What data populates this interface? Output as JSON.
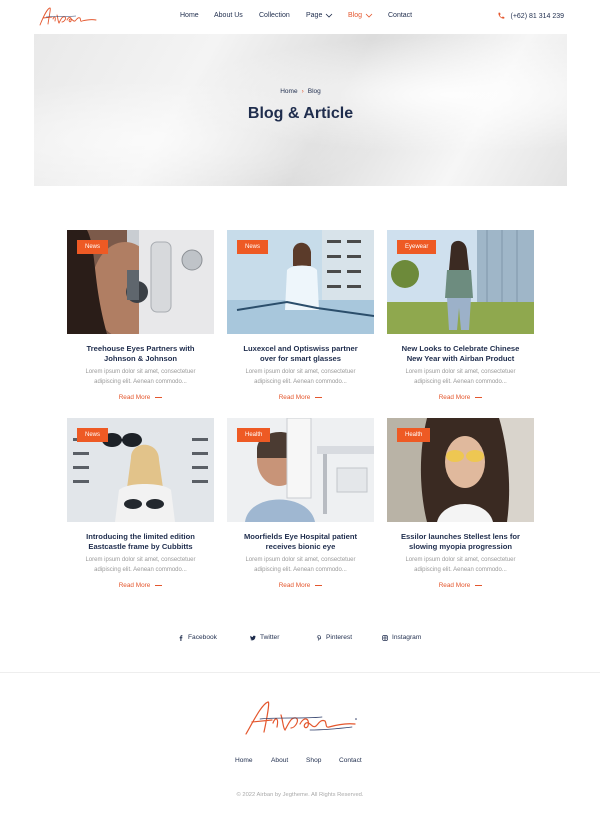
{
  "brand": {
    "name": "Airban",
    "accent": "#e4572e",
    "navy": "#1f2d4d"
  },
  "nav": {
    "items": [
      {
        "label": "Home"
      },
      {
        "label": "About Us"
      },
      {
        "label": "Collection"
      },
      {
        "label": "Page",
        "dropdown": true
      },
      {
        "label": "Blog",
        "dropdown": true,
        "active": true
      },
      {
        "label": "Contact"
      }
    ],
    "phone": "(+62) 81 314 239",
    "phone_icon": "phone-icon"
  },
  "hero": {
    "breadcrumb": {
      "home": "Home",
      "current": "Blog"
    },
    "title": "Blog & Article"
  },
  "cards": [
    {
      "tag": "News",
      "title_line1": "Treehouse Eyes Partners with",
      "title_line2": "Johnson & Johnson",
      "excerpt_line1": "Lorem ipsum dolor sit amet, consectetuer",
      "excerpt_line2": "adipiscing elit. Aenean commodo...",
      "read_more": "Read More"
    },
    {
      "tag": "News",
      "title_line1": "Luxexcel and Optiswiss partner",
      "title_line2": "over for smart glasses",
      "excerpt_line1": "Lorem ipsum dolor sit amet, consectetuer",
      "excerpt_line2": "adipiscing elit. Aenean commodo...",
      "read_more": "Read More"
    },
    {
      "tag": "Eyewear",
      "title_line1": "New Looks to Celebrate Chinese",
      "title_line2": "New Year with Airban Product",
      "excerpt_line1": "Lorem ipsum dolor sit amet, consectetuer",
      "excerpt_line2": "adipiscing elit. Aenean commodo...",
      "read_more": "Read More"
    },
    {
      "tag": "News",
      "title_line1": "Introducing the limited edition",
      "title_line2": "Eastcastle frame by Cubbitts",
      "excerpt_line1": "Lorem ipsum dolor sit amet, consectetuer",
      "excerpt_line2": "adipiscing elit. Aenean commodo...",
      "read_more": "Read More"
    },
    {
      "tag": "Health",
      "title_line1": "Moorfields Eye Hospital patient",
      "title_line2": "receives bionic eye",
      "excerpt_line1": "Lorem ipsum dolor sit amet, consectetuer",
      "excerpt_line2": "adipiscing elit. Aenean commodo...",
      "read_more": "Read More"
    },
    {
      "tag": "Health",
      "title_line1": "Essilor launches Stellest lens for",
      "title_line2": "slowing myopia progression",
      "excerpt_line1": "Lorem ipsum dolor sit amet, consectetuer",
      "excerpt_line2": "adipiscing elit. Aenean commodo...",
      "read_more": "Read More"
    }
  ],
  "social": [
    {
      "label": "Facebook",
      "icon": "facebook-icon"
    },
    {
      "label": "Twitter",
      "icon": "twitter-icon"
    },
    {
      "label": "Pinterest",
      "icon": "pinterest-icon"
    },
    {
      "label": "Instagram",
      "icon": "instagram-icon"
    }
  ],
  "footer": {
    "nav": [
      {
        "label": "Home"
      },
      {
        "label": "About"
      },
      {
        "label": "Shop"
      },
      {
        "label": "Contact"
      }
    ],
    "copyright": "© 2022 Airban by Jegtheme. All Rights Reserved."
  }
}
